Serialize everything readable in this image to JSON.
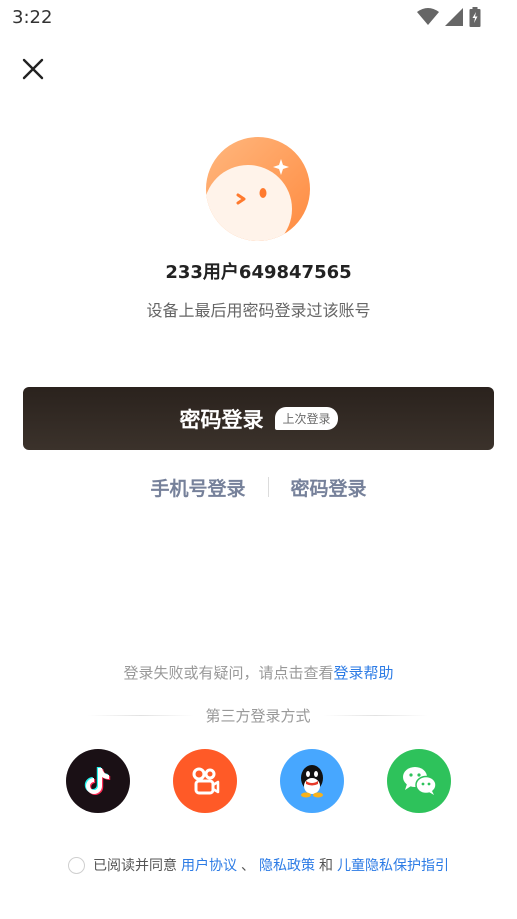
{
  "status_bar": {
    "time": "3:22",
    "icons": [
      "wifi-icon",
      "signal-icon",
      "battery-icon"
    ]
  },
  "header": {
    "close_icon": "close-icon"
  },
  "account": {
    "username": "233用户649847565",
    "hint": "设备上最后用密码登录过该账号"
  },
  "primary": {
    "label": "密码登录",
    "badge": "上次登录",
    "bg_color": "#2a221d"
  },
  "alt_methods": {
    "phone_label": "手机号登录",
    "password_label": "密码登录"
  },
  "help": {
    "prefix": "登录失败或有疑问，请点击查看",
    "link": "登录帮助"
  },
  "third_party": {
    "title": "第三方登录方式",
    "providers": [
      {
        "name": "douyin",
        "icon": "douyin-icon",
        "color": "#111111"
      },
      {
        "name": "kuaishou",
        "icon": "kuaishou-icon",
        "color": "#ff5a27"
      },
      {
        "name": "qq",
        "icon": "qq-icon",
        "color": "#47a7ff"
      },
      {
        "name": "wechat",
        "icon": "wechat-icon",
        "color": "#2ec25b"
      }
    ]
  },
  "agreement": {
    "prefix": "已阅读并同意",
    "user_agreement": "用户协议",
    "sep1": "、",
    "privacy_policy": "隐私政策",
    "conj": "和",
    "child_privacy": "儿童隐私保护指引"
  },
  "colors": {
    "link": "#2c7be5",
    "muted": "#999999",
    "alt_link": "#76819a"
  }
}
